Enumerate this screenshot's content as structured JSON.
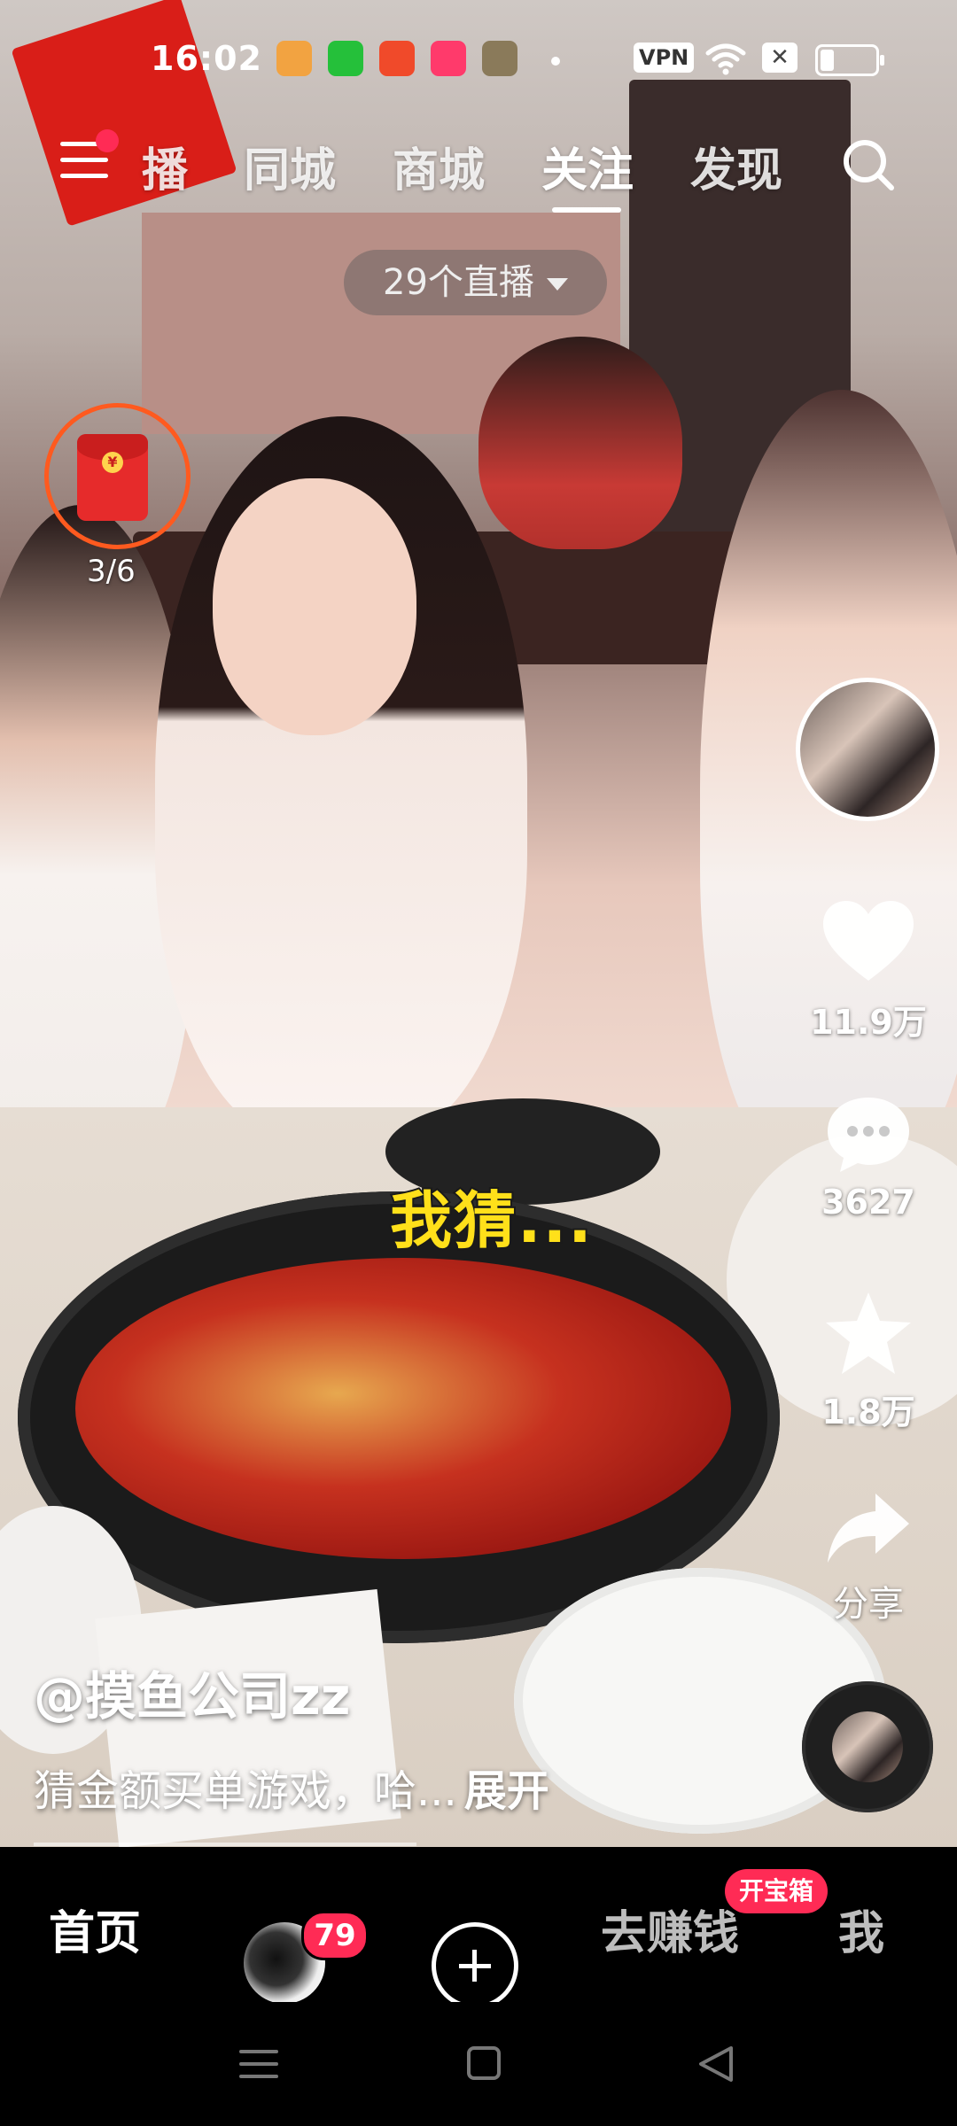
{
  "status_bar": {
    "time": "16:02",
    "vpn_label": "VPN",
    "battery_percent": 25
  },
  "top_nav": {
    "menu_badge": true,
    "tabs": [
      {
        "label": "播"
      },
      {
        "label": "同城"
      },
      {
        "label": "商城"
      },
      {
        "label": "关注"
      },
      {
        "label": "发现"
      }
    ],
    "active_tab": "关注"
  },
  "live": {
    "label": "29个直播"
  },
  "red_packet": {
    "progress": "3/6"
  },
  "right_rail": {
    "likes": "11.9万",
    "comments": "3627",
    "favorites": "1.8万",
    "share_label": "分享"
  },
  "video": {
    "sticker_text": "我猜...",
    "author": "@摸鱼公司zz",
    "description": "猜金额买单游戏，哈...",
    "expand_label": "展开",
    "progress_fraction": 0.43
  },
  "bottom_nav": {
    "home": "首页",
    "friends_badge": "79",
    "earn": "去赚钱",
    "earn_badge": "开宝箱",
    "me": "我"
  },
  "colors": {
    "accent": "#ff2b55",
    "redpacket_ring": "#ff5a1f",
    "sticker_yellow": "#ffe01a"
  }
}
